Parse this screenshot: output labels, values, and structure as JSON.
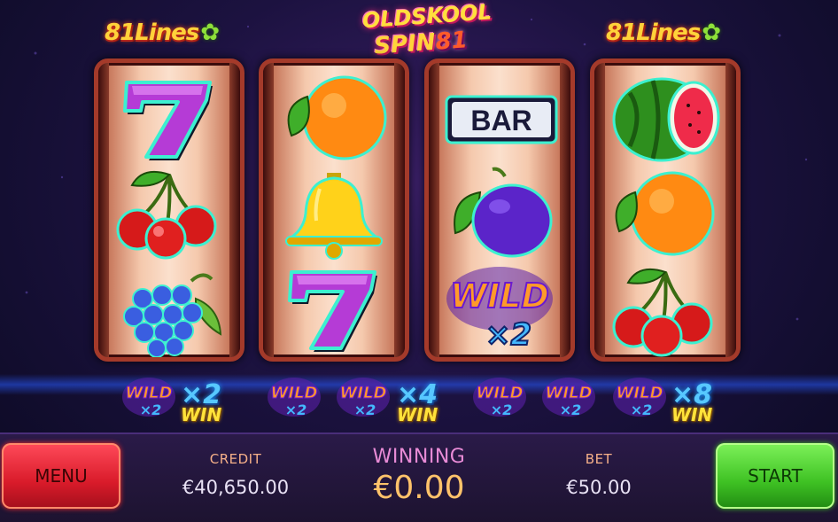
{
  "header": {
    "lines_badge_left": "81Lines",
    "lines_badge_right": "81Lines",
    "logo_line1": "OLDSKOOL",
    "logo_line2": "SPIN",
    "logo_number": "81"
  },
  "reels": [
    {
      "symbols": [
        "seven-icon",
        "cherries-icon",
        "grapes-icon"
      ]
    },
    {
      "symbols": [
        "orange-icon",
        "bell-icon",
        "seven-icon"
      ]
    },
    {
      "symbols": [
        "bar-icon",
        "plum-icon",
        "wild-x2-icon"
      ]
    },
    {
      "symbols": [
        "watermelon-icon",
        "orange-icon",
        "cherries-icon"
      ]
    }
  ],
  "symbol_text": {
    "bar": "BAR",
    "wild": "WILD",
    "wild_mult": "×2"
  },
  "wild_wins": [
    {
      "multiplier": "×2",
      "win": "WIN"
    },
    {
      "multiplier": "×4",
      "win": "WIN"
    },
    {
      "multiplier": "×8",
      "win": "WIN"
    }
  ],
  "bottom_bar": {
    "menu_label": "MENU",
    "start_label": "START",
    "credit_label": "CREDIT",
    "credit_value": "€40,650.00",
    "winning_label": "WINNING",
    "winning_value": "€0.00",
    "bet_label": "BET",
    "bet_value": "€50.00"
  },
  "colors": {
    "menu_button": "#d91b2a",
    "start_button": "#3ec123",
    "winning_value": "#ffc36a",
    "reel_frame": "#a43a2a"
  }
}
